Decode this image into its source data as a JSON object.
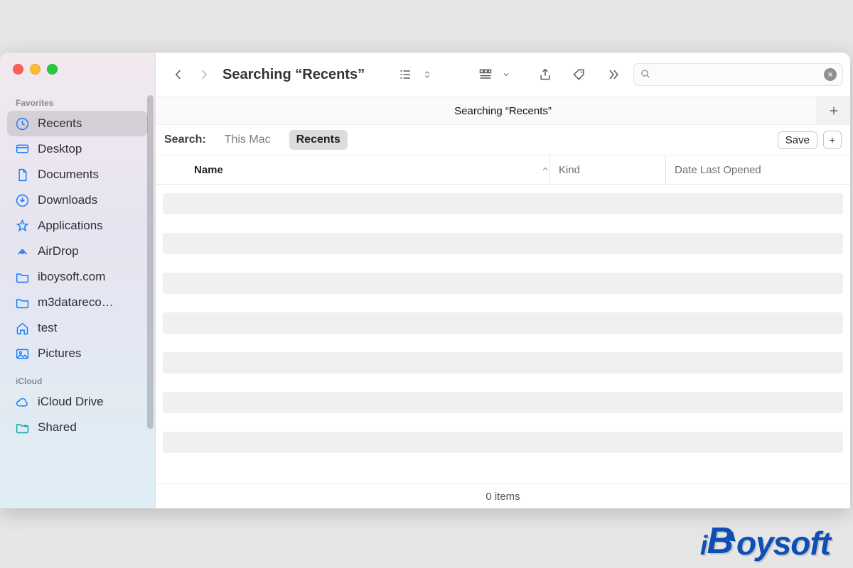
{
  "toolbar": {
    "title": "Searching “Recents”"
  },
  "pathbar": {
    "text": "Searching “Recents”"
  },
  "sidebar": {
    "sections": {
      "favorites_label": "Favorites",
      "icloud_label": "iCloud"
    },
    "favorites": [
      {
        "label": "Recents"
      },
      {
        "label": "Desktop"
      },
      {
        "label": "Documents"
      },
      {
        "label": "Downloads"
      },
      {
        "label": "Applications"
      },
      {
        "label": "AirDrop"
      },
      {
        "label": "iboysoft.com"
      },
      {
        "label": "m3datareco…"
      },
      {
        "label": "test"
      },
      {
        "label": "Pictures"
      }
    ],
    "icloud": [
      {
        "label": "iCloud Drive"
      },
      {
        "label": "Shared"
      }
    ]
  },
  "scopebar": {
    "label": "Search:",
    "this_mac": "This Mac",
    "recents": "Recents",
    "save": "Save",
    "plus": "+"
  },
  "columns": {
    "name": "Name",
    "kind": "Kind",
    "date": "Date Last Opened"
  },
  "status": {
    "items": "0 items"
  },
  "watermark": {
    "text": "iBoysoft"
  }
}
